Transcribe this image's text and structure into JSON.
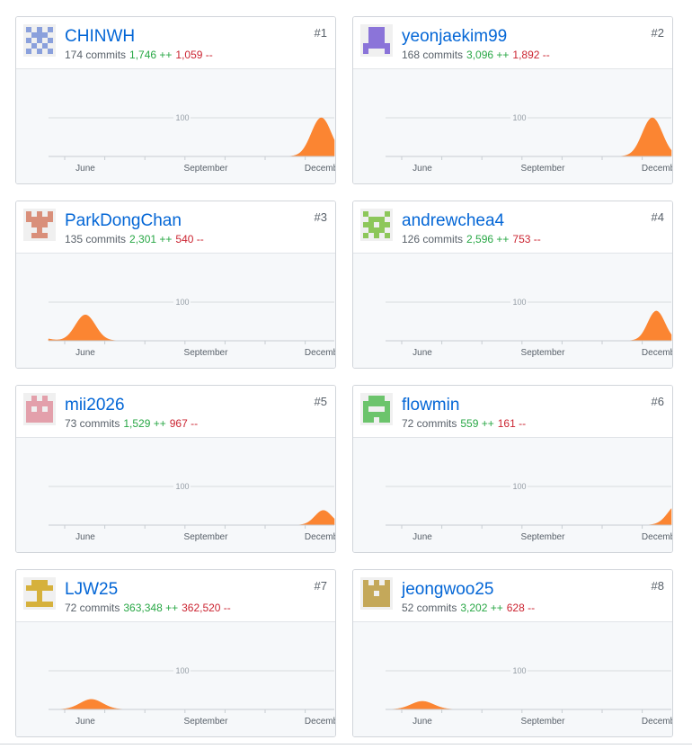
{
  "contributors": [
    {
      "rank": "#1",
      "username": "CHINWH",
      "commits": "174 commits",
      "additions": "1,746 ++",
      "deletions": "1,059 --",
      "avatar_color": "#8aa0dc",
      "avatar_pattern": [
        "10101",
        "01110",
        "10101",
        "01010",
        "10101"
      ],
      "chart_data": {
        "type": "area",
        "x_ticks": [
          "June",
          "September",
          "December"
        ],
        "y_tick": "100",
        "series": [
          {
            "peak_month": 11.9,
            "peak_value": 100,
            "width": 0.35
          }
        ]
      }
    },
    {
      "rank": "#2",
      "username": "yeonjaekim99",
      "commits": "168 commits",
      "additions": "3,096 ++",
      "deletions": "1,892 --",
      "avatar_color": "#8b74d9",
      "avatar_pattern": [
        "01110",
        "01110",
        "01110",
        "11111",
        "10001"
      ],
      "chart_data": {
        "type": "area",
        "x_ticks": [
          "June",
          "September",
          "December"
        ],
        "y_tick": "100",
        "series": [
          {
            "peak_month": 11.75,
            "peak_value": 100,
            "width": 0.35
          }
        ]
      }
    },
    {
      "rank": "#3",
      "username": "ParkDongChan",
      "commits": "135 commits",
      "additions": "2,301 ++",
      "deletions": "540 --",
      "avatar_color": "#d98f7a",
      "avatar_pattern": [
        "10101",
        "11111",
        "01110",
        "00100",
        "01110"
      ],
      "chart_data": {
        "type": "area",
        "x_ticks": [
          "June",
          "September",
          "December"
        ],
        "y_tick": "100",
        "series": [
          {
            "peak_month": 6.0,
            "peak_value": 67,
            "width": 0.35
          },
          {
            "peak_month": 4.9,
            "peak_value": 7,
            "width": 0.3
          }
        ]
      }
    },
    {
      "rank": "#4",
      "username": "andrewchea4",
      "commits": "126 commits",
      "additions": "2,596 ++",
      "deletions": "753 --",
      "avatar_color": "#8dc75a",
      "avatar_pattern": [
        "10001",
        "01110",
        "11011",
        "01110",
        "10101"
      ],
      "chart_data": {
        "type": "area",
        "x_ticks": [
          "June",
          "September",
          "December"
        ],
        "y_tick": "100",
        "series": [
          {
            "peak_month": 11.85,
            "peak_value": 77,
            "width": 0.3
          }
        ]
      }
    },
    {
      "rank": "#5",
      "username": "mii2026",
      "commits": "73 commits",
      "additions": "1,529 ++",
      "deletions": "967 --",
      "avatar_color": "#e3a0ab",
      "avatar_pattern": [
        "01010",
        "11111",
        "10101",
        "11111",
        "11111"
      ],
      "chart_data": {
        "type": "area",
        "x_ticks": [
          "June",
          "September",
          "December"
        ],
        "y_tick": "100",
        "series": [
          {
            "peak_month": 11.95,
            "peak_value": 38,
            "width": 0.3
          }
        ]
      }
    },
    {
      "rank": "#6",
      "username": "flowmin",
      "commits": "72 commits",
      "additions": "559 ++",
      "deletions": "161 --",
      "avatar_color": "#6cc46c",
      "avatar_pattern": [
        "01110",
        "11111",
        "10001",
        "11111",
        "11011"
      ],
      "chart_data": {
        "type": "area",
        "x_ticks": [
          "June",
          "September",
          "December"
        ],
        "y_tick": "100",
        "series": [
          {
            "peak_month": 12.4,
            "peak_value": 55,
            "width": 0.35
          }
        ]
      }
    },
    {
      "rank": "#7",
      "username": "LJW25",
      "commits": "72 commits",
      "additions": "363,348 ++",
      "deletions": "362,520 --",
      "avatar_color": "#d6b13c",
      "avatar_pattern": [
        "01110",
        "11111",
        "00100",
        "00100",
        "11111"
      ],
      "chart_data": {
        "type": "area",
        "x_ticks": [
          "June",
          "September",
          "December"
        ],
        "y_tick": "100",
        "series": [
          {
            "peak_month": 6.15,
            "peak_value": 26,
            "width": 0.4
          }
        ]
      }
    },
    {
      "rank": "#8",
      "username": "jeongwoo25",
      "commits": "52 commits",
      "additions": "3,202 ++",
      "deletions": "628 --",
      "avatar_color": "#c4a85a",
      "avatar_pattern": [
        "10101",
        "11111",
        "11011",
        "11111",
        "11111"
      ],
      "chart_data": {
        "type": "area",
        "x_ticks": [
          "June",
          "September",
          "December"
        ],
        "y_tick": "100",
        "series": [
          {
            "peak_month": 6.0,
            "peak_value": 21,
            "width": 0.4
          }
        ]
      }
    }
  ]
}
